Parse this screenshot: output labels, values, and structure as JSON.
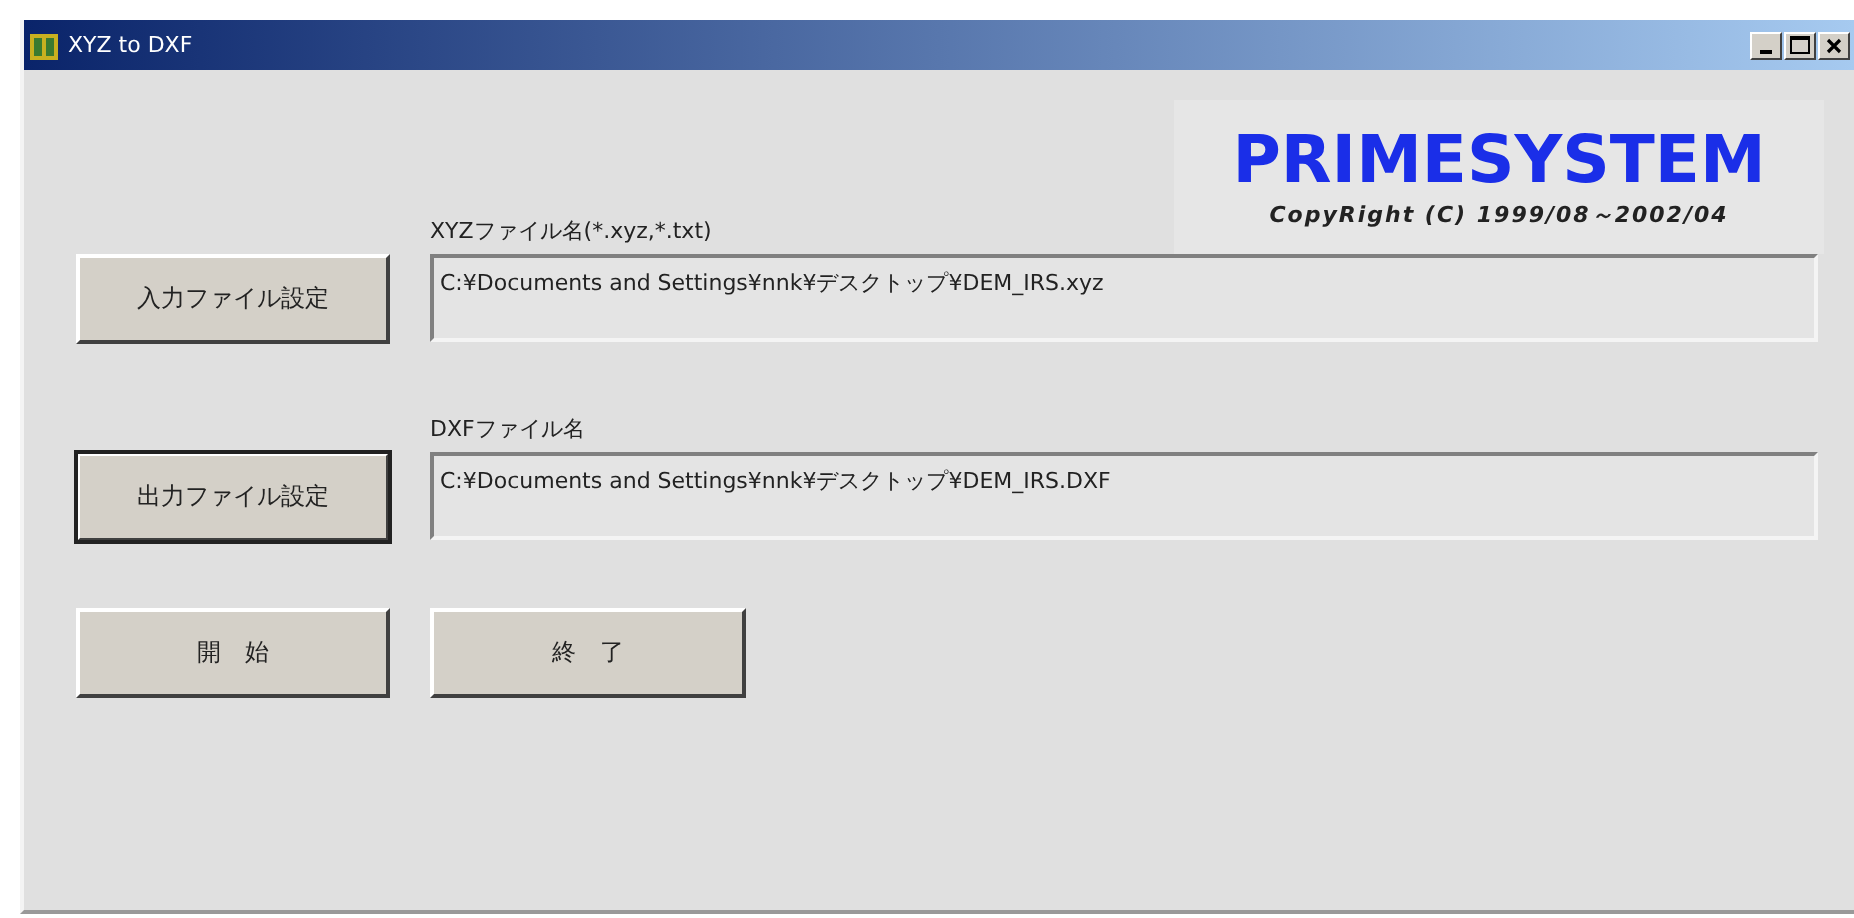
{
  "window": {
    "title": "XYZ to DXF"
  },
  "logo": {
    "name": "PRIMESYSTEM",
    "copyright": "CopyRight (C) 1999/08～2002/04"
  },
  "rows": [
    {
      "label": "XYZファイル名(*.xyz,*.txt)",
      "button": {
        "label": "入力ファイル設定",
        "focused": false
      },
      "field": {
        "value": "C:¥Documents and Settings¥nnk¥デスクトップ¥DEM_IRS.xyz"
      }
    },
    {
      "label": "DXFファイル名",
      "button": {
        "label": "出力ファイル設定",
        "focused": true
      },
      "field": {
        "value": "C:¥Documents and Settings¥nnk¥デスクトップ¥DEM_IRS.DXF"
      }
    }
  ],
  "actions": [
    {
      "label": "開　始",
      "kind": "start"
    },
    {
      "label": "終　了",
      "kind": "exit"
    }
  ]
}
